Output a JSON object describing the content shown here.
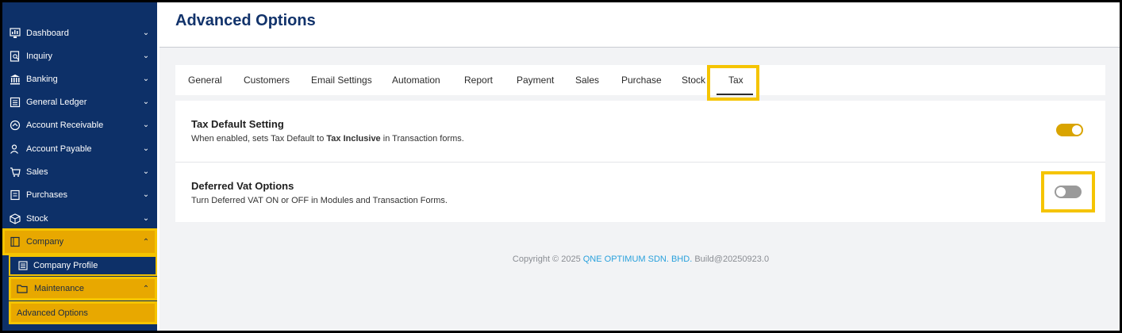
{
  "sidebar": {
    "items": [
      {
        "label": "Dashboard",
        "icon": "dashboard-icon"
      },
      {
        "label": "Inquiry",
        "icon": "inquiry-icon"
      },
      {
        "label": "Banking",
        "icon": "bank-icon"
      },
      {
        "label": "General Ledger",
        "icon": "ledger-icon"
      },
      {
        "label": "Account Receivable",
        "icon": "receivable-icon"
      },
      {
        "label": "Account Payable",
        "icon": "payable-icon"
      },
      {
        "label": "Sales",
        "icon": "sales-icon"
      },
      {
        "label": "Purchases",
        "icon": "purchases-icon"
      },
      {
        "label": "Stock",
        "icon": "stock-icon"
      },
      {
        "label": "Company",
        "icon": "company-icon"
      }
    ],
    "company_sub": {
      "profile_label": "Company Profile"
    },
    "maintenance": {
      "label": "Maintenance",
      "sub_label": "Advanced Options"
    }
  },
  "header": {
    "title": "Advanced Options"
  },
  "tabs": [
    "General",
    "Customers",
    "Email Settings",
    "Automation",
    "Report",
    "Payment",
    "Sales",
    "Purchase",
    "Stock",
    "Tax"
  ],
  "active_tab": "Tax",
  "settings": {
    "tax_default": {
      "title": "Tax Default Setting",
      "desc_prefix": "When enabled, sets Tax Default to ",
      "desc_bold": "Tax Inclusive",
      "desc_suffix": " in Transaction forms.",
      "enabled": true
    },
    "deferred_vat": {
      "title": "Deferred Vat Options",
      "desc": "Turn Deferred VAT ON or OFF in Modules and Transaction Forms.",
      "enabled": false
    }
  },
  "footer": {
    "prefix": "Copyright © 2025 ",
    "company": "QNE OPTIMUM SDN. BHD.",
    "build": " Build@20250923.0"
  },
  "colors": {
    "sidebar_bg": "#0d3068",
    "highlight": "#f5c400",
    "toggle_on": "#d9a400",
    "toggle_off": "#9a9a9a",
    "title": "#12336b",
    "footer_link": "#2aa1dc"
  }
}
